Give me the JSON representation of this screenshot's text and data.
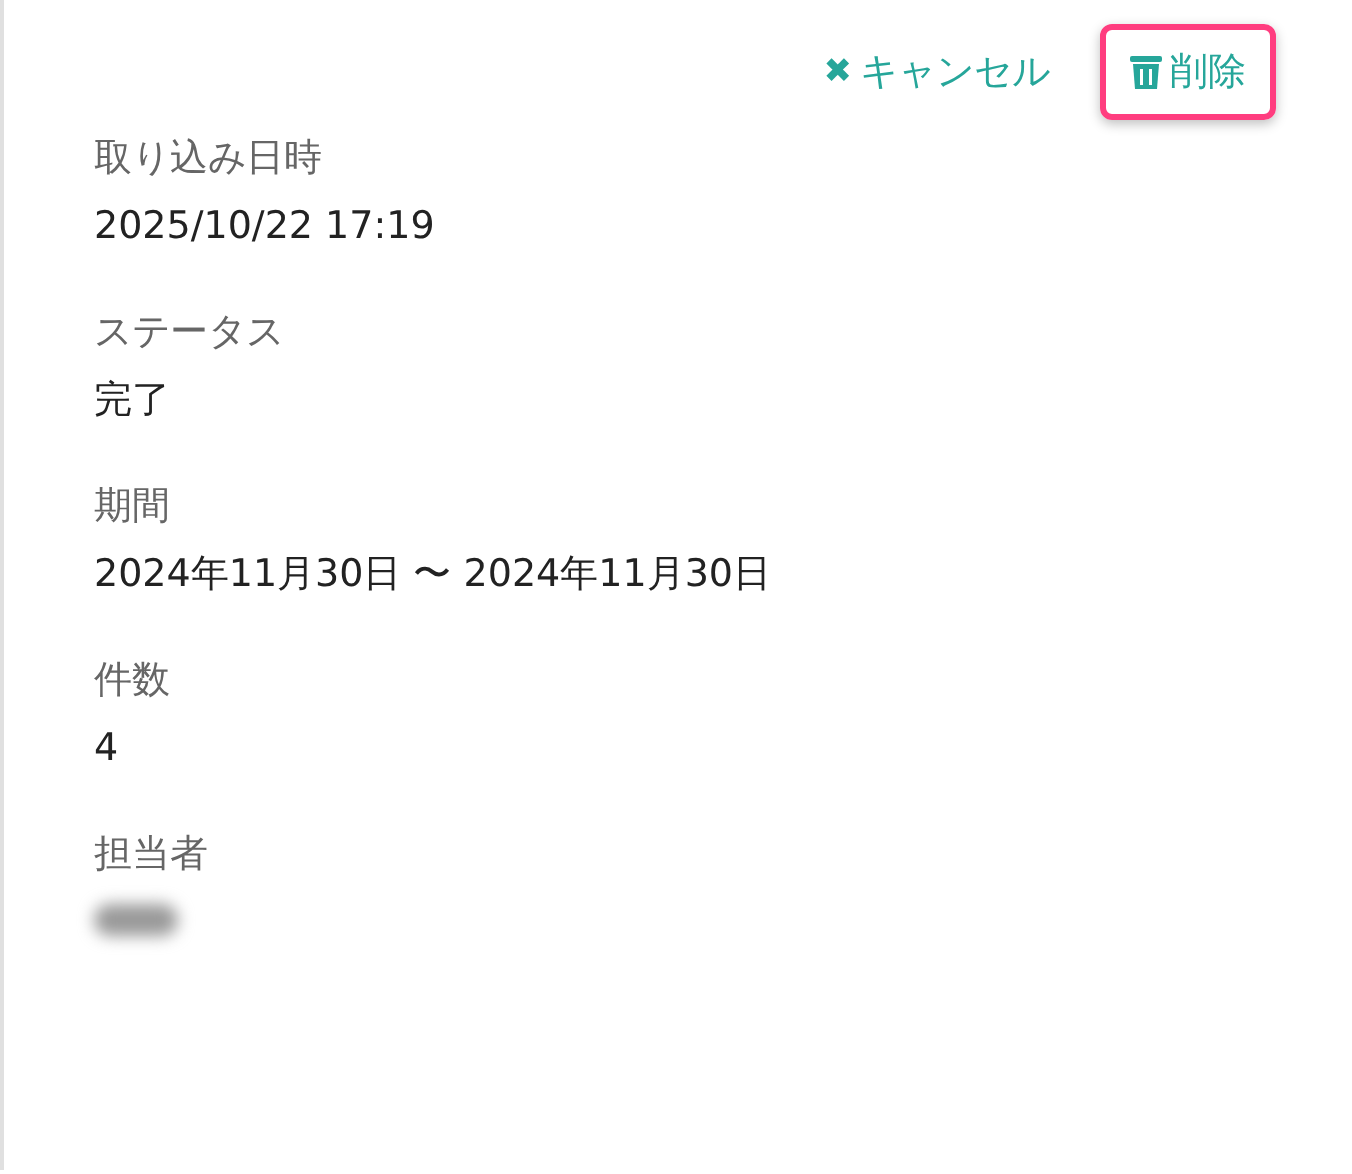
{
  "actions": [
    {
      "kind": "cancel",
      "icon": "✖",
      "label": "キャンセル",
      "highlighted": false
    },
    {
      "kind": "delete",
      "label": "削除",
      "highlighted": true
    }
  ],
  "fields": [
    {
      "label": "取り込み日時",
      "value": "2025/10/22 17:19"
    },
    {
      "label": "ステータス",
      "value": "完了"
    },
    {
      "label": "期間",
      "value": "2024年11月30日 〜 2024年11月30日"
    },
    {
      "label": "件数",
      "value": "4"
    },
    {
      "label": "担当者",
      "kind": "redacted"
    }
  ]
}
